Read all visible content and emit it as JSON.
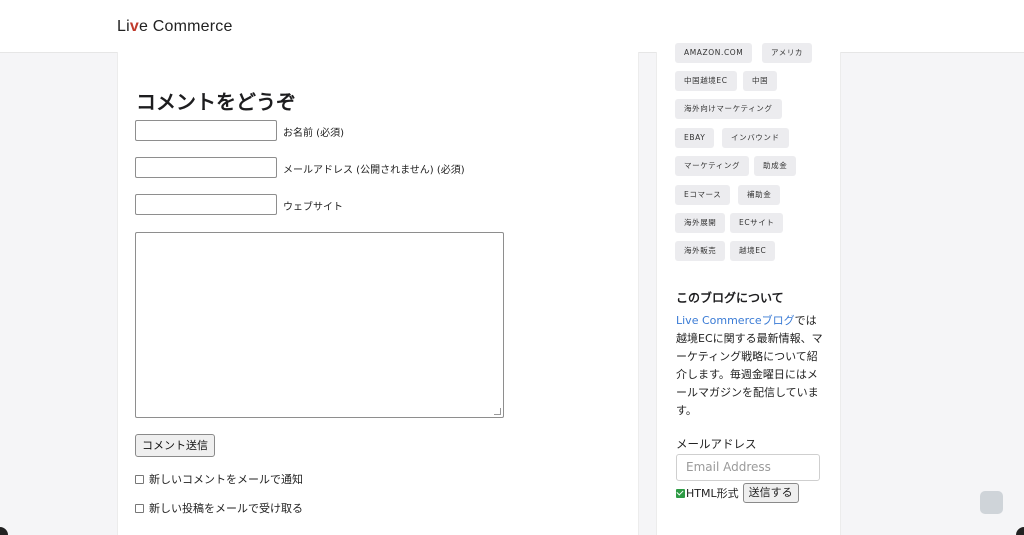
{
  "header": {
    "logo_pre": "Li",
    "logo_v": "v",
    "logo_post": "e Commerce"
  },
  "comment_form": {
    "title": "コメントをどうぞ",
    "name_label": "お名前 (必須)",
    "email_label": "メールアドレス (公開されません) (必須)",
    "website_label": "ウェブサイト",
    "submit_label": "コメント送信",
    "notify_comments_label": "新しいコメントをメールで通知",
    "notify_posts_label": "新しい投稿をメールで受け取る"
  },
  "sidebar": {
    "tags": [
      "AMAZON.COM",
      "アメリカ",
      "中国越境EC",
      "中国",
      "海外向けマーケティング",
      "EBAY",
      "インバウンド",
      "マーケティング",
      "助成金",
      "Eコマース",
      "補助金",
      "海外展開",
      "ECサイト",
      "海外販売",
      "越境EC"
    ],
    "about_title": "このブログについて",
    "about_link": "Live Commerceブログ",
    "about_text": "では越境ECに関する最新情報、マーケティング戦略について紹介します。毎週金曜日にはメールマガジンを配信しています。",
    "email_label": "メールアドレス",
    "email_placeholder": "Email Address",
    "html_format_label": "HTML形式",
    "send_label": "送信する"
  },
  "colors": {
    "link": "#3a7bd5",
    "checkbox_accent": "#2e9b45"
  }
}
